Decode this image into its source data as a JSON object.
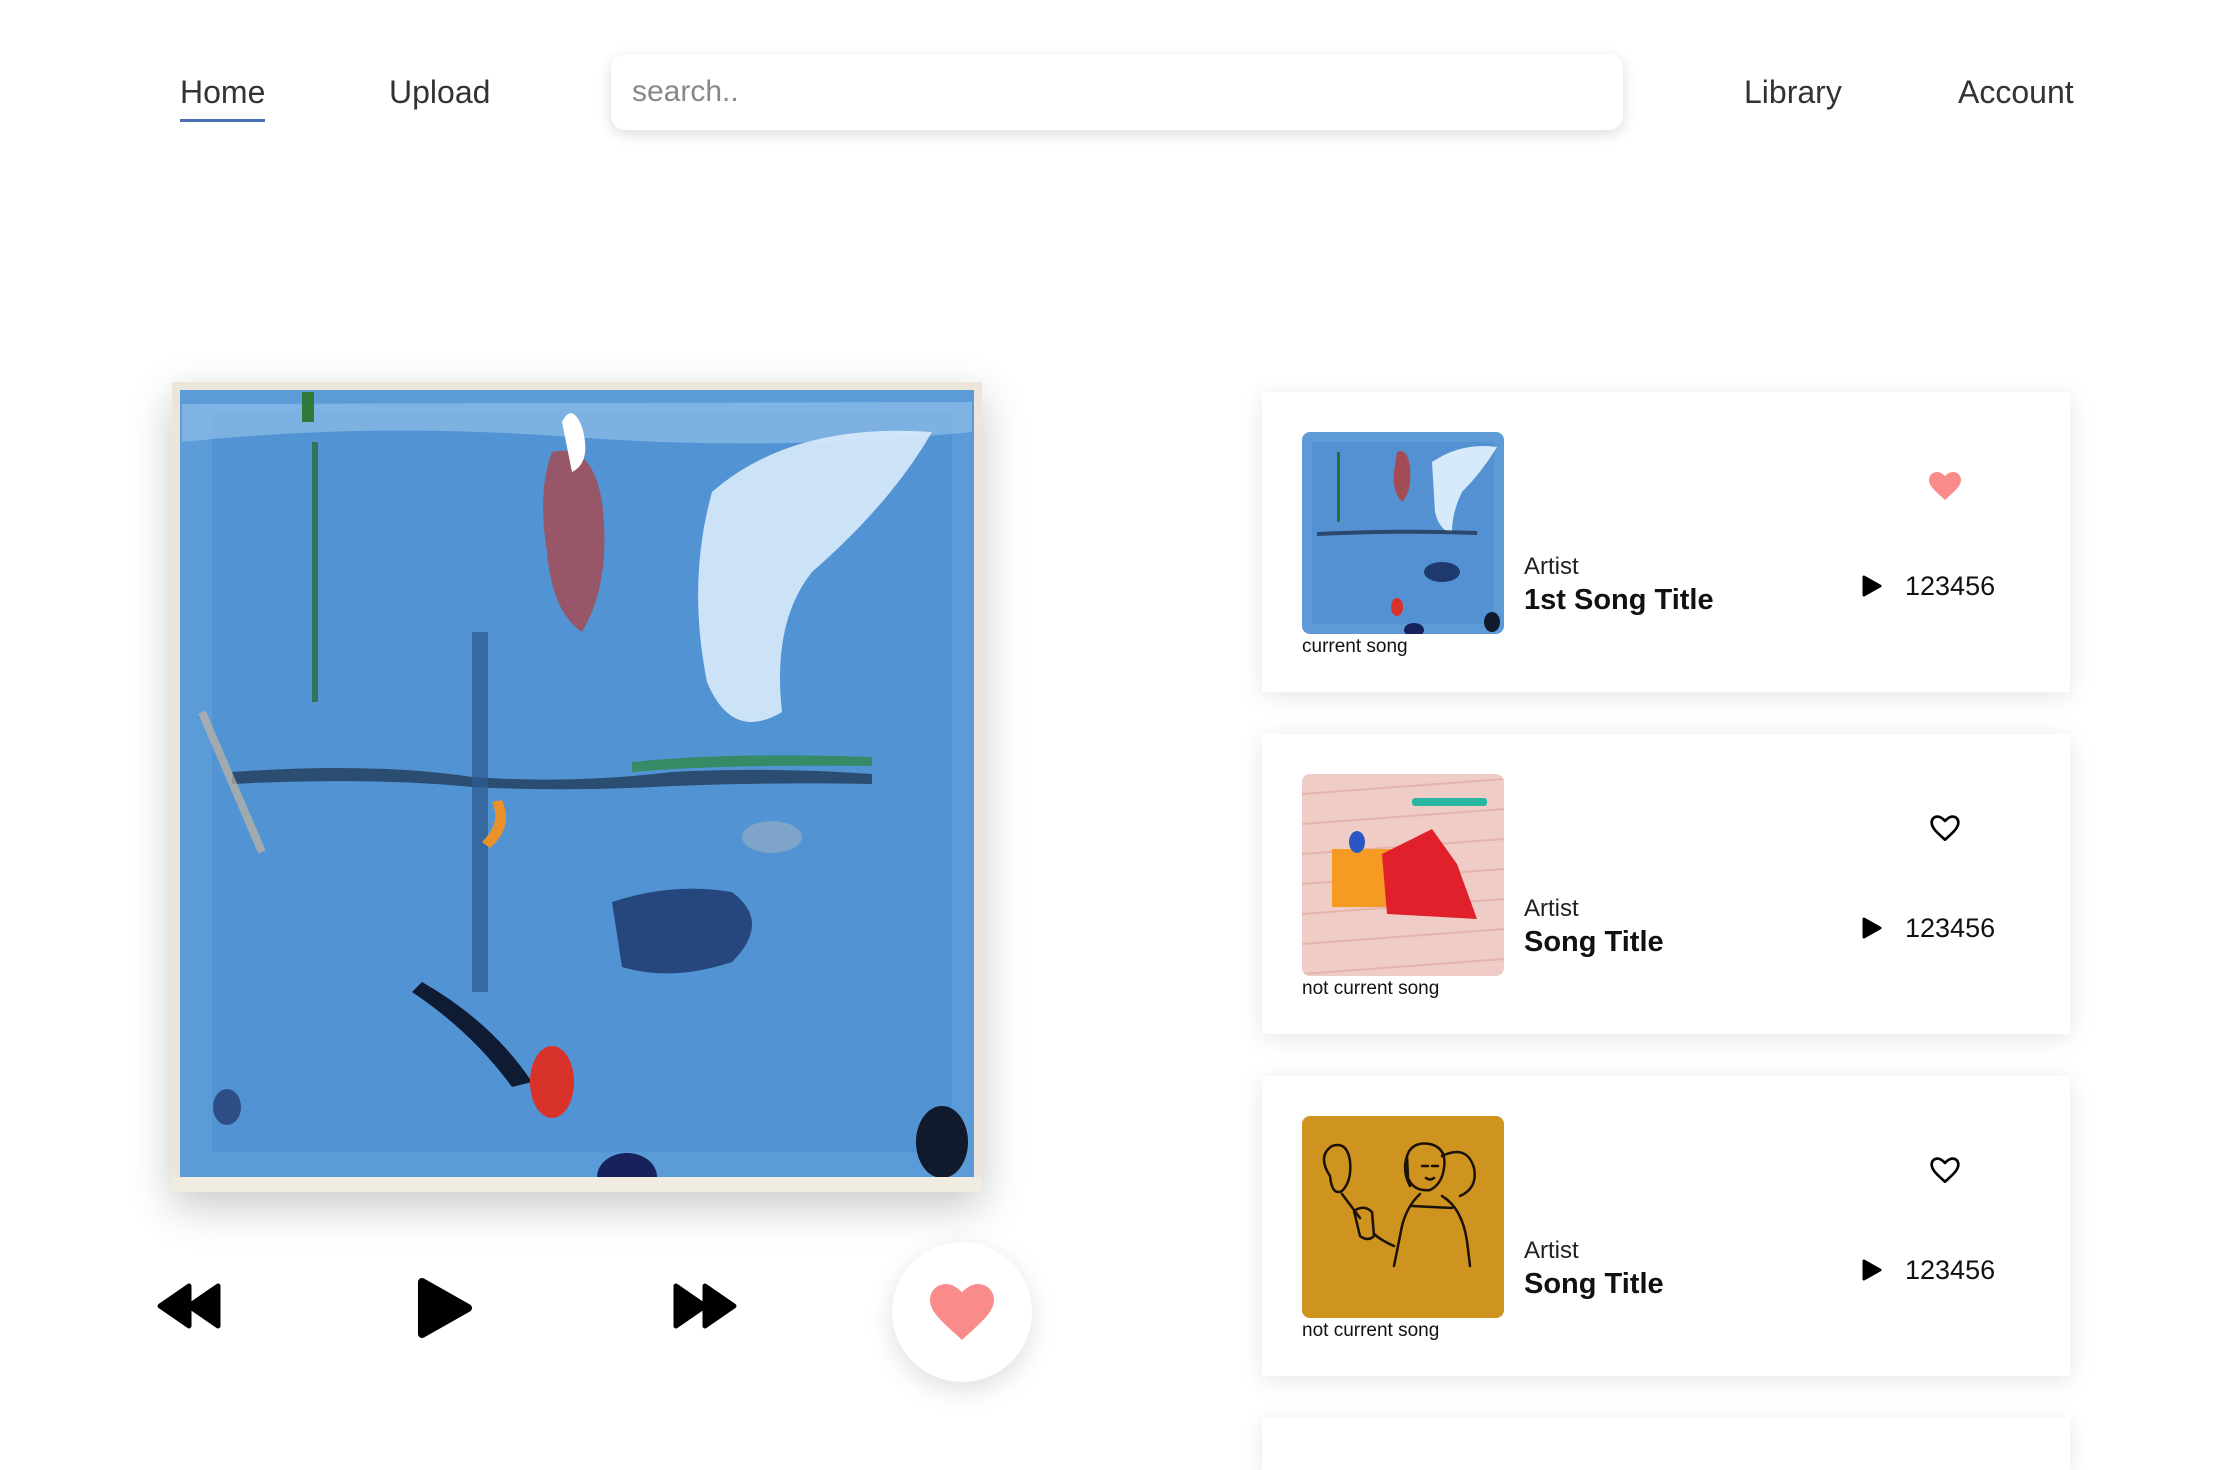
{
  "nav": {
    "home": "Home",
    "upload": "Upload",
    "library": "Library",
    "account": "Account"
  },
  "search": {
    "placeholder": "search..",
    "value": ""
  },
  "player": {
    "liked": true,
    "controls": [
      "rewind-icon",
      "play-icon",
      "fast-forward-icon",
      "heart-icon"
    ]
  },
  "songs": [
    {
      "artist": "Artist",
      "title": "1st Song Title",
      "plays": "123456",
      "status": "current song",
      "liked": true,
      "art": "blue-abstract"
    },
    {
      "artist": "Artist",
      "title": "Song Title",
      "plays": "123456",
      "status": "not current song",
      "liked": false,
      "art": "pink-red-abstract"
    },
    {
      "artist": "Artist",
      "title": "Song Title",
      "plays": "123456",
      "status": "not current song",
      "liked": false,
      "art": "mustard-figure-drawing"
    }
  ],
  "colors": {
    "accent_heart": "#f98c8a",
    "nav_underline": "#4a6fb5",
    "mustard": "#cf931f"
  }
}
